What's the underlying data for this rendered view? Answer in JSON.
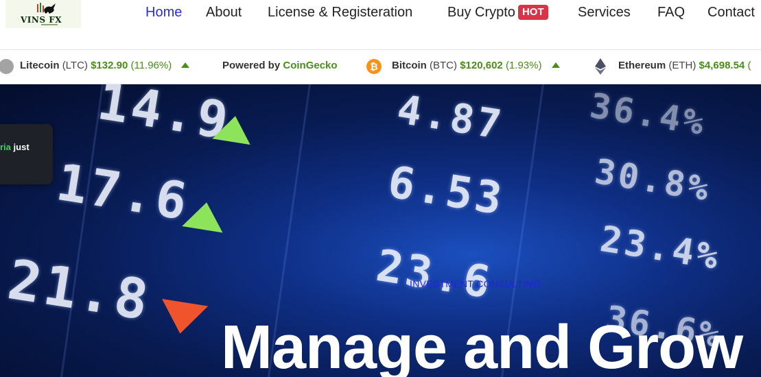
{
  "logo": {
    "text": "VINS FX"
  },
  "nav": {
    "items": [
      {
        "label": "Home",
        "active": true
      },
      {
        "label": "About"
      },
      {
        "label": "License & Registeration"
      },
      {
        "label": "Buy Crypto",
        "badge": "HOT"
      },
      {
        "label": "Services"
      },
      {
        "label": "FAQ"
      },
      {
        "label": "Contact"
      }
    ]
  },
  "ticker": {
    "litecoin": {
      "name": "Litecoin",
      "symbol": "(LTC)",
      "price": "$132.90",
      "change": "(11.96%)"
    },
    "powered": {
      "prefix": "Powered by",
      "brand": "CoinGecko"
    },
    "bitcoin": {
      "name": "Bitcoin",
      "symbol": "(BTC)",
      "price": "$120,602",
      "change": "(1.93%)",
      "icon_glyph": "₿"
    },
    "ethereum": {
      "name": "Ethereum",
      "symbol": "(ETH)",
      "price": "$4,698.54",
      "change": "("
    }
  },
  "hero": {
    "board": [
      "14.9",
      "17.6",
      "21.8",
      "4.87",
      "6.53",
      "23.6",
      "36.4%",
      "30.8%",
      "23.4%",
      "36.6%"
    ],
    "toast": {
      "highlight": "ria",
      "text": "just"
    },
    "eyebrow": "INVESTMENT CONSULTING",
    "headline": "Manage and Grow"
  },
  "colors": {
    "accent": "#2b2bdf",
    "hot": "#d9334a",
    "positive": "#4a8d17",
    "toast_highlight": "#38d65a"
  }
}
